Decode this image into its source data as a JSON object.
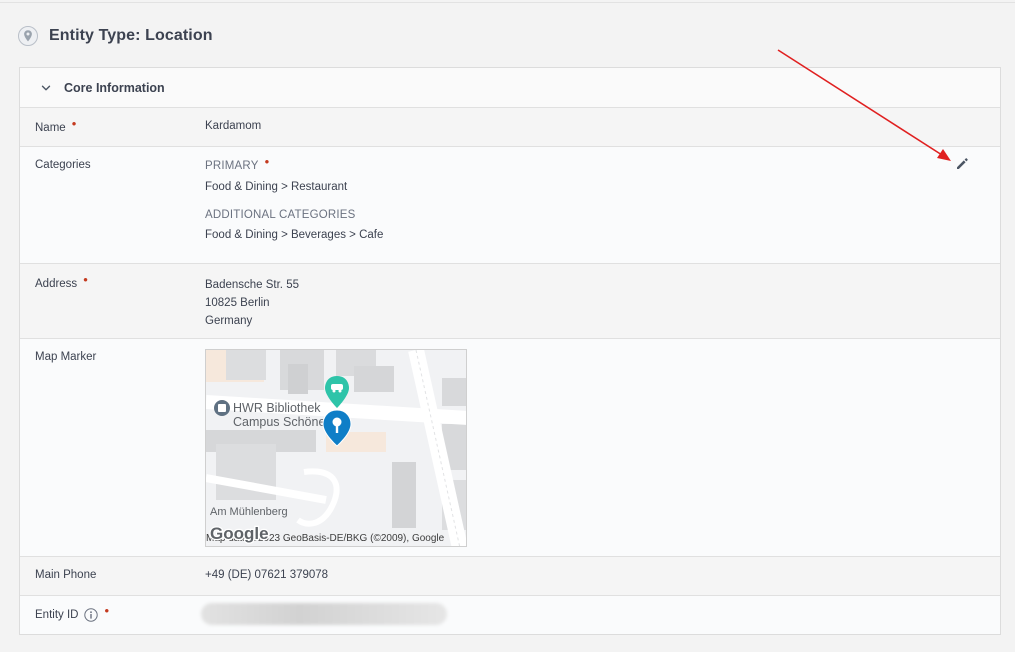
{
  "page": {
    "title": "Entity Type: Location"
  },
  "section": {
    "title": "Core Information"
  },
  "fields": {
    "name": {
      "label": "Name",
      "value": "Kardamom"
    },
    "categories": {
      "label": "Categories",
      "primary_label": "PRIMARY",
      "primary_value": "Food & Dining > Restaurant",
      "additional_label": "ADDITIONAL CATEGORIES",
      "additional_value": "Food & Dining > Beverages > Cafe"
    },
    "address": {
      "label": "Address",
      "line1": "Badensche Str. 55",
      "line2": "10825 Berlin",
      "line3": "Germany"
    },
    "map_marker": {
      "label": "Map Marker",
      "poi_line1": "HWR Bibliothek",
      "poi_line2": "Campus Schöneberg",
      "street_label": "Am Mühlenberg",
      "google_logo": "Google",
      "attribution": "Map data ©2023 GeoBasis-DE/BKG (©2009), Google"
    },
    "main_phone": {
      "label": "Main Phone",
      "value": "+49 (DE) 07621 379078"
    },
    "entity_id": {
      "label": "Entity ID"
    }
  },
  "icons": {
    "title": "location-pin-icon",
    "section_toggle": "chevron-down-icon",
    "edit": "pencil-icon",
    "info": "info-icon",
    "map_pin": "map-pin-icon",
    "parking": "car-marker-icon",
    "library": "book-poi-icon"
  },
  "colors": {
    "required_marker": "#c43a1f",
    "map_pin": "#0f7ec7",
    "parking_marker": "#2ec4a9",
    "annotation_arrow": "#e02020"
  }
}
